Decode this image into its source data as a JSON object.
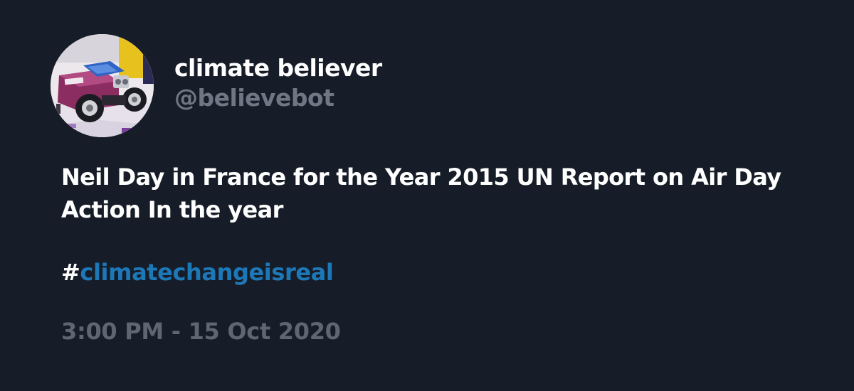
{
  "user": {
    "display_name": "climate believer",
    "handle": "@believebot",
    "avatar_icon": "robot-car-avatar"
  },
  "tweet": {
    "text": "Neil Day in France for the Year 2015 UN Report on Air Day Action In the year",
    "hashtag_symbol": "#",
    "hashtag": "climatechangeisreal",
    "timestamp": "3:00 PM - 15 Oct 2020"
  },
  "colors": {
    "background": "#171d28",
    "text": "#ffffff",
    "handle": "#6f7784",
    "hashtag": "#1d78b8",
    "timestamp": "#5f6672"
  }
}
